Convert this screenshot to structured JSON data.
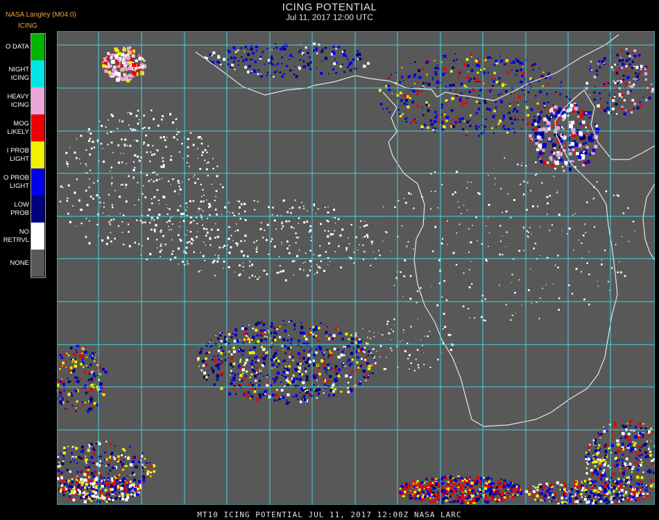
{
  "header": {
    "org": "NASA Langley (M04.0)",
    "product": "ICING",
    "title": "ICING POTENTIAL",
    "datetime": "Jul 11, 2017 12:00 UTC"
  },
  "legend": [
    {
      "label": "O DATA",
      "color": "#00b400"
    },
    {
      "label": "NIGHT\nICING",
      "color": "#00e5e5"
    },
    {
      "label": "HEAVY\nICING",
      "color": "#e8a8d8"
    },
    {
      "label": "MOG\nLIKELY",
      "color": "#ee0000"
    },
    {
      "label": "I PROB\nLIGHT",
      "color": "#f0f000"
    },
    {
      "label": "O PROB\nLIGHT",
      "color": "#0000ee"
    },
    {
      "label": "LOW\nPROB",
      "color": "#000080"
    },
    {
      "label": "NO\nRETRVL",
      "color": "#ffffff"
    },
    {
      "label": "NONE",
      "color": "#585858"
    }
  ],
  "colors": {
    "background": "#585858",
    "grid": "#40d8e0",
    "coast": "#e8e8e8",
    "grid_label": "#c03030"
  },
  "footer": "MT10   ICING POTENTIAL    JUL 11, 2017 12:00Z   NASA LARC"
}
